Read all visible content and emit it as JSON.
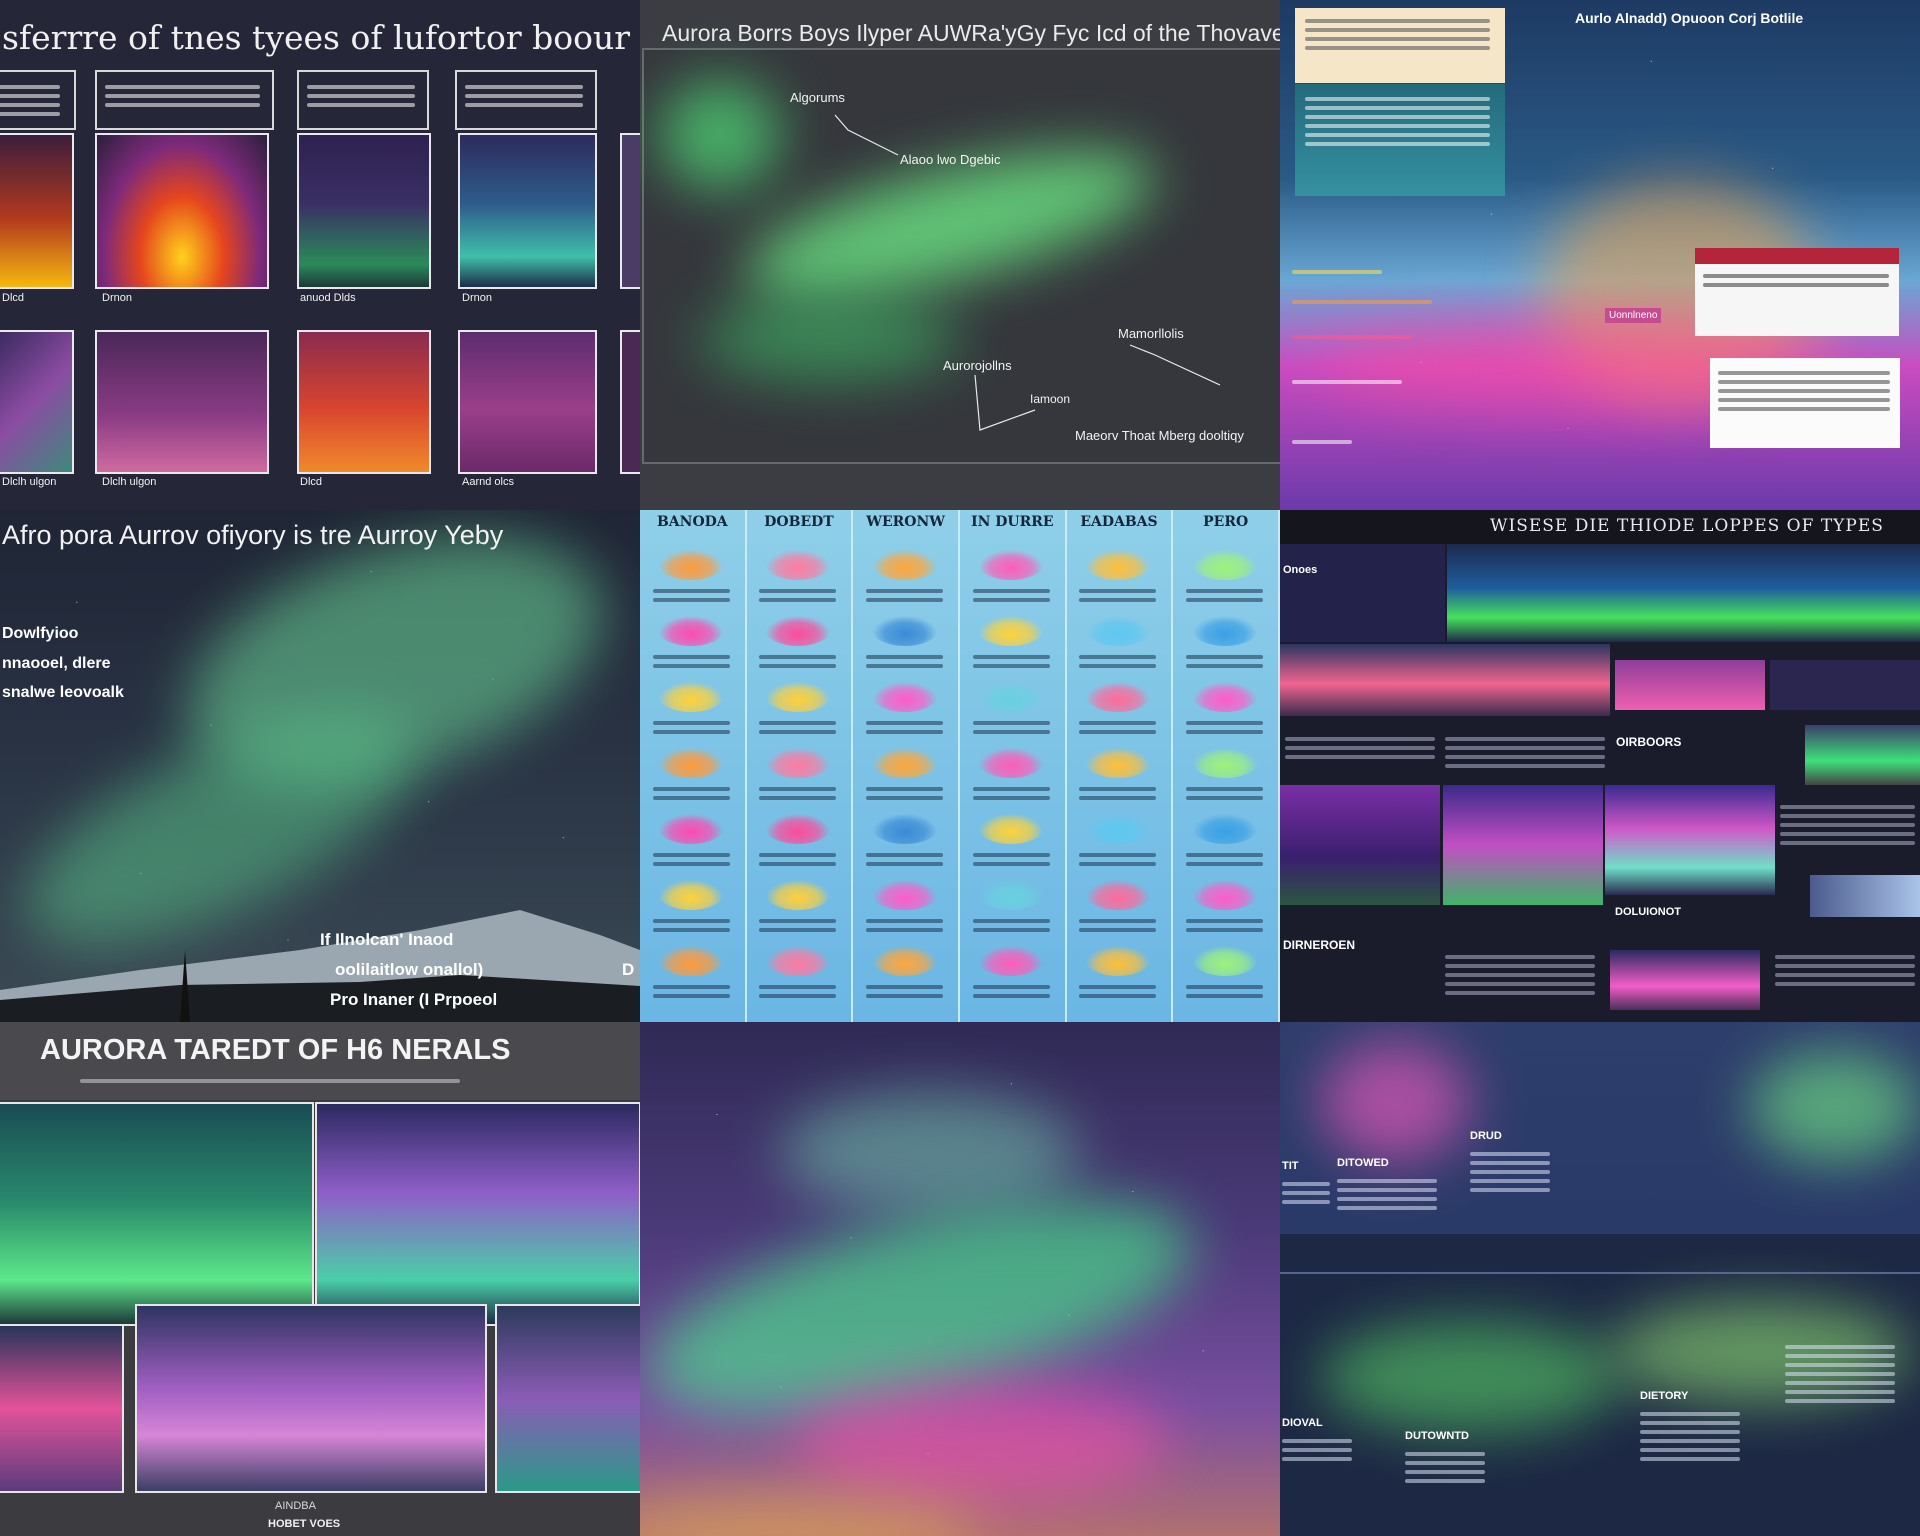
{
  "tiles": {
    "t1": {
      "title": "sferrre of tnes tyees of lufortor boour of tteer",
      "captions": [
        "Dlcd",
        "anuod Dlds",
        "Drnon",
        "Dlclh ulgon",
        "Aarnd olcs"
      ]
    },
    "t2": {
      "title": "Aurora Borrs Boys Ilyper AUWRa'yGy Fyc Icd of the Thovave",
      "labels": [
        "Algorums",
        "Alaoo lwo Dgebic",
        "Aurorojollns",
        "Mamorllolis",
        "Iamoon",
        "Maeorv Thoat Mberg dooltiqy"
      ]
    },
    "t3": {
      "title": "Aurlo Alnadd) Opuoon Corj Botlile",
      "labels": [
        "Uonnlneno"
      ]
    },
    "t4": {
      "title": "Afro pora Aurrov ofiyory is tre Aurroy Yeby",
      "left_lines": [
        "Dowlfyioo",
        "nnaooel, dlere",
        "snalwe leovoalk"
      ],
      "bottom_lines": [
        "If Ilnolcan' Inaod",
        "oolilaitlow onallol)",
        "Pro Inaner (I Prpoeol"
      ],
      "edge_letter": "D"
    },
    "t5": {
      "headers": [
        "BANODA",
        "DOBEDT",
        "WERONW",
        "IN DURRE",
        "EADABAS",
        "PERO"
      ]
    },
    "t6": {
      "title": "WISESE DIE THIODE LOPPES OF TYPES",
      "labels": [
        "Onoes",
        "OIRBOORS",
        "DIRNEROEN",
        "DOLUIONOT"
      ]
    },
    "t7": {
      "title": "AURORA TAREDT OF H6 NERALS",
      "footer_top": "AINDBA",
      "footer_bottom": "HOBET VOES"
    },
    "t9": {
      "labels": [
        "DITOWED",
        "DRUD",
        "TIT"
      ],
      "bottom_labels": [
        "DIOVAL",
        "DUTOWNTD",
        "DIETORY"
      ]
    }
  }
}
